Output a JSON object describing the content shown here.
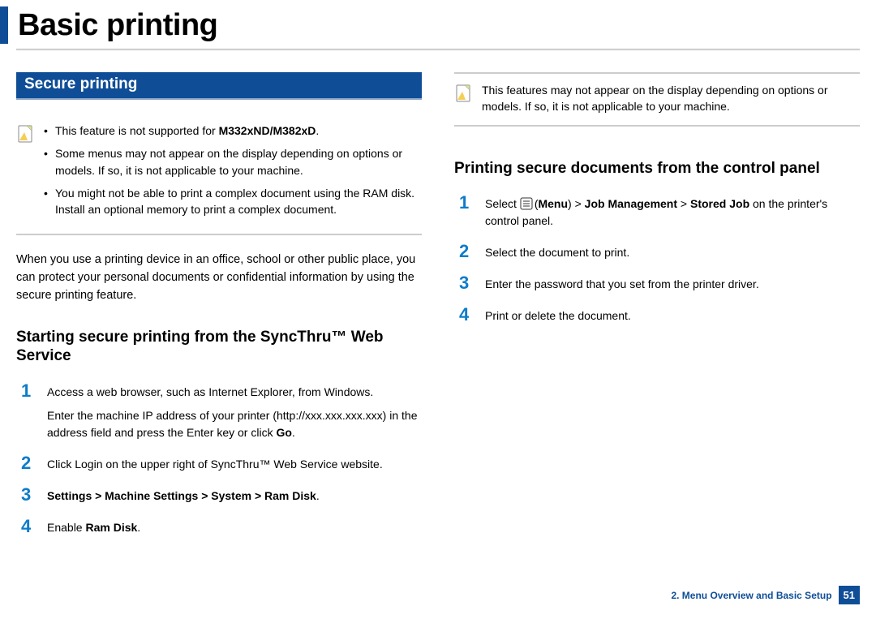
{
  "pageTitle": "Basic printing",
  "left": {
    "sectionHeader": "Secure printing",
    "noteBullets": [
      {
        "pre": "This feature is not supported for ",
        "bold": "M332xND/M382xD",
        "post": "."
      },
      {
        "pre": "Some menus may not appear on the display depending on options or models. If so, it is not applicable to your machine.",
        "bold": "",
        "post": ""
      },
      {
        "pre": "You might not be able to print a complex document using the RAM disk. Install an optional memory to print a complex document.",
        "bold": "",
        "post": ""
      }
    ],
    "bodyText": "When you use a printing device in an office, school or other public place, you can protect your personal documents or confidential information by using the secure printing feature.",
    "subheading": "Starting secure printing from the SyncThru™ Web Service",
    "steps": [
      {
        "num": "1",
        "paras": [
          {
            "pre": "Access a web browser, such as Internet Explorer, from Windows.",
            "bold": "",
            "post": ""
          },
          {
            "pre": "Enter the machine IP address of your printer (http://xxx.xxx.xxx.xxx) in the address field and press the Enter key or click ",
            "bold": "Go",
            "post": "."
          }
        ]
      },
      {
        "num": "2",
        "paras": [
          {
            "pre": "Click Login on the upper right of SyncThru™ Web Service website.",
            "bold": "",
            "post": ""
          }
        ]
      },
      {
        "num": "3",
        "paras": [
          {
            "pre": "",
            "bold": "Settings > Machine Settings > System > Ram Disk",
            "post": "."
          }
        ]
      },
      {
        "num": "4",
        "paras": [
          {
            "pre": "Enable ",
            "bold": "Ram Disk",
            "post": "."
          }
        ]
      }
    ]
  },
  "right": {
    "noteText": "This features may not appear on the display depending on options or models. If so, it is not applicable to your machine.",
    "subheading": "Printing secure documents from the control panel",
    "steps": [
      {
        "num": "1",
        "style": "menu",
        "pre": "Select ",
        "menuLabel": "Menu",
        "mid": " > ",
        "bold2": "Job Management",
        "mid2": " > ",
        "bold3": "Stored Job",
        "post": " on the printer's control panel."
      },
      {
        "num": "2",
        "text": "Select the document to print."
      },
      {
        "num": "3",
        "text": "Enter the password that you set from the printer driver."
      },
      {
        "num": "4",
        "text": "Print or delete the document."
      }
    ]
  },
  "footer": {
    "chapter": "2. Menu Overview and Basic Setup",
    "page": "51"
  }
}
